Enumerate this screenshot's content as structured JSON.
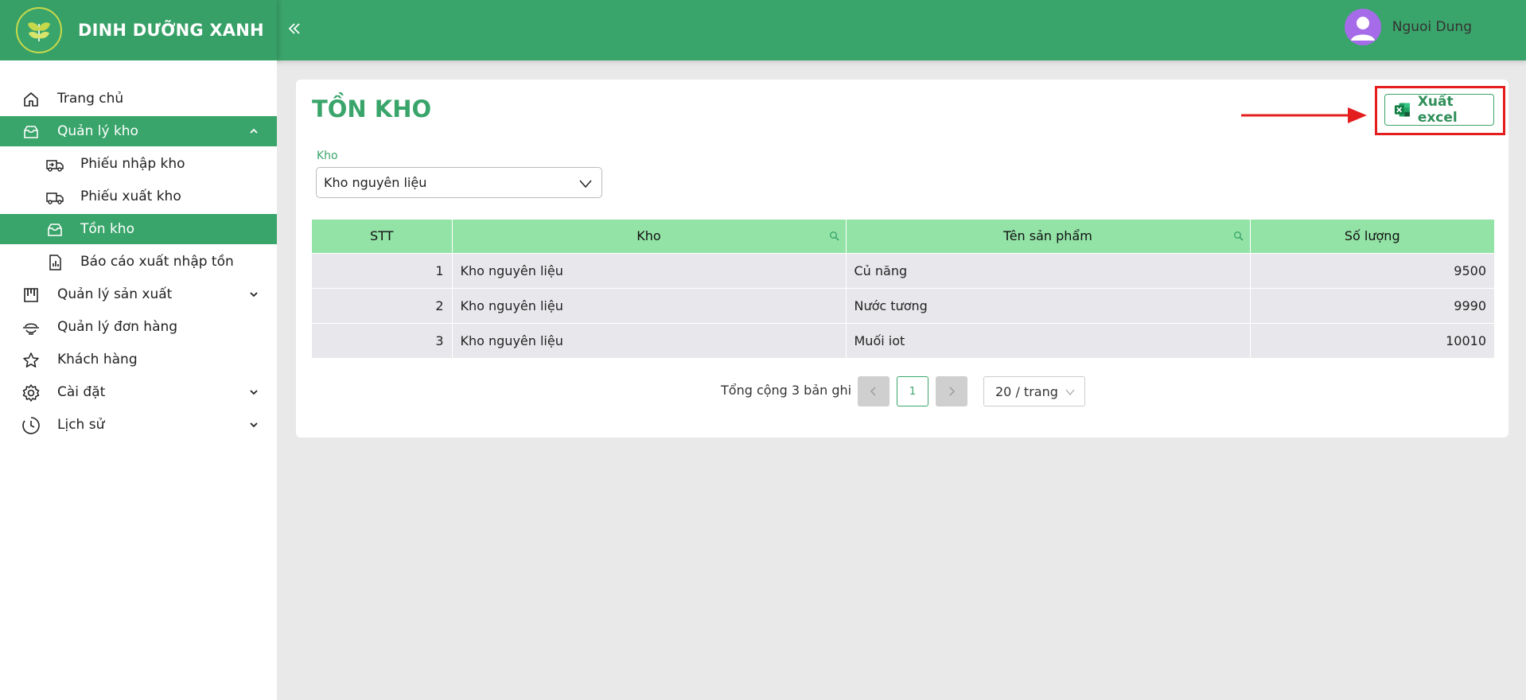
{
  "header": {
    "brand": "DINH DƯỠNG XANH",
    "collapse_icon": "double-chevron-left-icon",
    "user_name": "Nguoi Dung"
  },
  "sidebar": {
    "items": [
      {
        "label": "Trang chủ",
        "icon": "home-icon"
      },
      {
        "label": "Quản lý kho",
        "icon": "inbox-icon",
        "expanded": true
      },
      {
        "label": "Phiếu nhập kho",
        "icon": "truck-in-icon"
      },
      {
        "label": "Phiếu xuất kho",
        "icon": "truck-out-icon"
      },
      {
        "label": "Tồn kho",
        "icon": "inbox-icon",
        "active": true
      },
      {
        "label": "Báo cáo xuất nhập tồn",
        "icon": "report-icon"
      },
      {
        "label": "Quản lý sản xuất",
        "icon": "factory-icon"
      },
      {
        "label": "Quản lý đơn hàng",
        "icon": "order-icon"
      },
      {
        "label": "Khách hàng",
        "icon": "star-icon"
      },
      {
        "label": "Cài đặt",
        "icon": "gear-icon"
      },
      {
        "label": "Lịch sử",
        "icon": "clock-icon"
      }
    ]
  },
  "main": {
    "title": "TỒN KHO",
    "export_label": "Xuất excel",
    "filter": {
      "label": "Kho",
      "value": "Kho nguyên liệu"
    },
    "table": {
      "columns": [
        "STT",
        "Kho",
        "Tên sản phẩm",
        "Số lượng"
      ],
      "rows": [
        {
          "stt": "1",
          "kho": "Kho nguyên liệu",
          "ten": "Củ năng",
          "sl": "9500"
        },
        {
          "stt": "2",
          "kho": "Kho nguyên liệu",
          "ten": "Nước tương",
          "sl": "9990"
        },
        {
          "stt": "3",
          "kho": "Kho nguyên liệu",
          "ten": "Muối iot",
          "sl": "10010"
        }
      ]
    },
    "pagination": {
      "total": "Tổng cộng 3 bản ghi",
      "current": "1",
      "page_size": "20 / trang"
    }
  },
  "colors": {
    "brand": "#3aa56b",
    "header_row": "#93e3a7",
    "highlight": "#e41e1e"
  }
}
